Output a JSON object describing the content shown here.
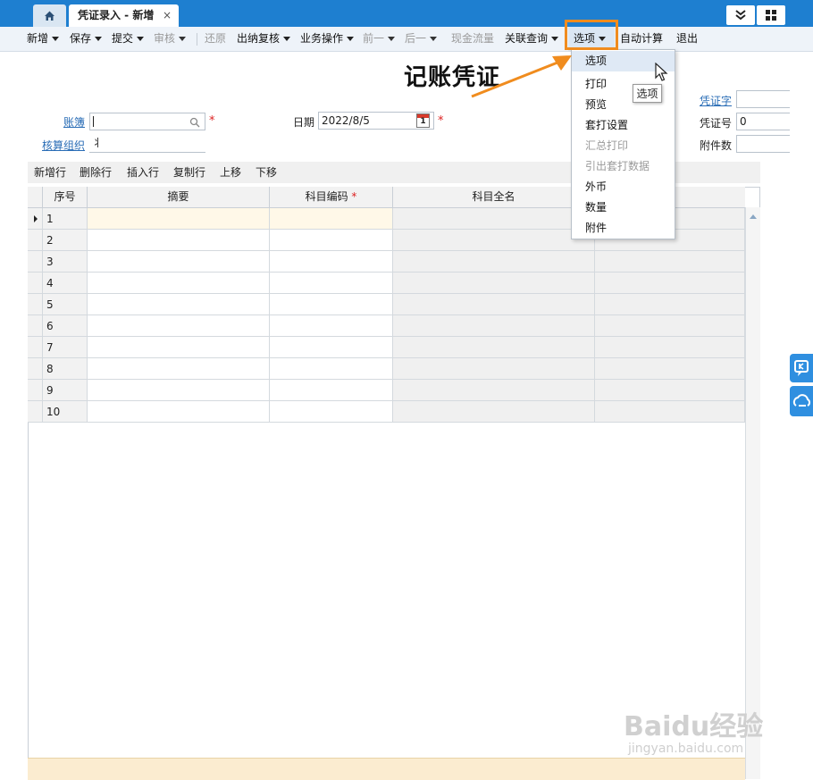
{
  "tabs": {
    "doc_title": "凭证录入 - 新增",
    "close": "×"
  },
  "toolbar": {
    "new": "新增",
    "save": "保存",
    "submit": "提交",
    "audit": "审核",
    "restore": "还原",
    "cashier_review": "出纳复核",
    "business_ops": "业务操作",
    "prev": "前一",
    "next": "后一",
    "cash_flow": "现金流量",
    "related_query": "关联查询",
    "options": "选项",
    "auto_calc": "自动计算",
    "exit": "退出"
  },
  "annotation": {
    "title": "记账凭证"
  },
  "form": {
    "book_label": "账簿",
    "book_value": "",
    "org_label": "核算组织",
    "org_value": "丬",
    "date_label": "日期",
    "date_value": "2022/8/5",
    "calendar_day": "1",
    "voucher_word_label": "凭证字",
    "voucher_word_value": "",
    "voucher_no_label": "凭证号",
    "voucher_no_value": "0",
    "attachments_label": "附件数",
    "attachments_value": "",
    "required_mark": "*"
  },
  "entry_toolbar": {
    "add_row": "新增行",
    "delete_row": "删除行",
    "insert_row": "插入行",
    "copy_row": "复制行",
    "move_up": "上移",
    "move_down": "下移"
  },
  "grid": {
    "headers": {
      "no": "序号",
      "summary": "摘要",
      "code": "科目编码",
      "name": "科目全名"
    },
    "rows": [
      "1",
      "2",
      "3",
      "4",
      "5",
      "6",
      "7",
      "8",
      "9",
      "10"
    ]
  },
  "menu": {
    "items": [
      {
        "label": "选项",
        "disabled": false
      },
      {
        "label": "打印",
        "disabled": false
      },
      {
        "label": "预览",
        "disabled": false
      },
      {
        "label": "套打设置",
        "disabled": false
      },
      {
        "label": "汇总打印",
        "disabled": true
      },
      {
        "label": "引出套打数据",
        "disabled": true
      },
      {
        "label": "外币",
        "disabled": false
      },
      {
        "label": "数量",
        "disabled": false
      },
      {
        "label": "附件",
        "disabled": false
      }
    ],
    "tooltip": "选项"
  },
  "watermark": {
    "brand": "Baidu经验",
    "url": "jingyan.baidu.com"
  },
  "colors": {
    "accent": "#1e7fd0",
    "highlight": "#f08c1e",
    "required": "#dd2222"
  }
}
